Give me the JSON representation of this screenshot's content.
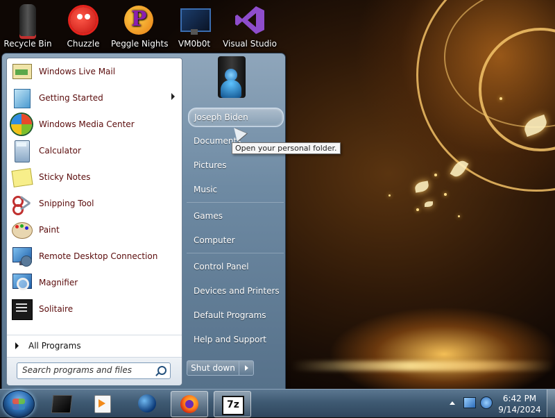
{
  "desktop": {
    "icons": [
      {
        "label": "Recycle Bin",
        "icon": "recycle-bin-icon"
      },
      {
        "label": "Chuzzle",
        "icon": "chuzzle-icon"
      },
      {
        "label": "Peggle Nights",
        "icon": "peggle-nights-icon"
      },
      {
        "label": "VM0b0t",
        "icon": "vm0b0t-icon"
      },
      {
        "label": "Visual Studio",
        "icon": "visual-studio-icon"
      }
    ]
  },
  "start_menu": {
    "programs": [
      {
        "label": "Windows Live Mail",
        "icon": "mail-icon"
      },
      {
        "label": "Getting Started",
        "icon": "getting-started-icon",
        "has_submenu": true
      },
      {
        "label": "Windows Media Center",
        "icon": "media-center-icon"
      },
      {
        "label": "Calculator",
        "icon": "calculator-icon"
      },
      {
        "label": "Sticky Notes",
        "icon": "sticky-notes-icon"
      },
      {
        "label": "Snipping Tool",
        "icon": "scissors-icon"
      },
      {
        "label": "Paint",
        "icon": "paint-palette-icon"
      },
      {
        "label": "Remote Desktop Connection",
        "icon": "remote-desktop-icon"
      },
      {
        "label": "Magnifier",
        "icon": "magnifier-icon"
      },
      {
        "label": "Solitaire",
        "icon": "solitaire-icon"
      }
    ],
    "all_programs": "All Programs",
    "search_placeholder": "Search programs and files",
    "user_name": "Joseph Biden",
    "right_items": [
      "Documents",
      "Pictures",
      "Music",
      "Games",
      "Computer",
      "Control Panel",
      "Devices and Printers",
      "Default Programs",
      "Help and Support"
    ],
    "shutdown_label": "Shut down",
    "tooltip": "Open your personal folder."
  },
  "taskbar": {
    "pinned": [
      {
        "icon": "black-box-icon",
        "active": false
      },
      {
        "icon": "media-player-icon",
        "active": false
      },
      {
        "icon": "globe-icon",
        "active": false
      },
      {
        "icon": "firefox-icon",
        "active": true
      },
      {
        "icon": "7zip-icon",
        "active": true,
        "text": "7z"
      }
    ],
    "time": "6:42 PM",
    "date": "9/14/2024"
  },
  "colors": {
    "program_label": "#5a0b0b",
    "start_menu_right": "#6e8aa3",
    "taskbar": "#3f5a73",
    "wallpaper_glow": "#f4c46a"
  }
}
